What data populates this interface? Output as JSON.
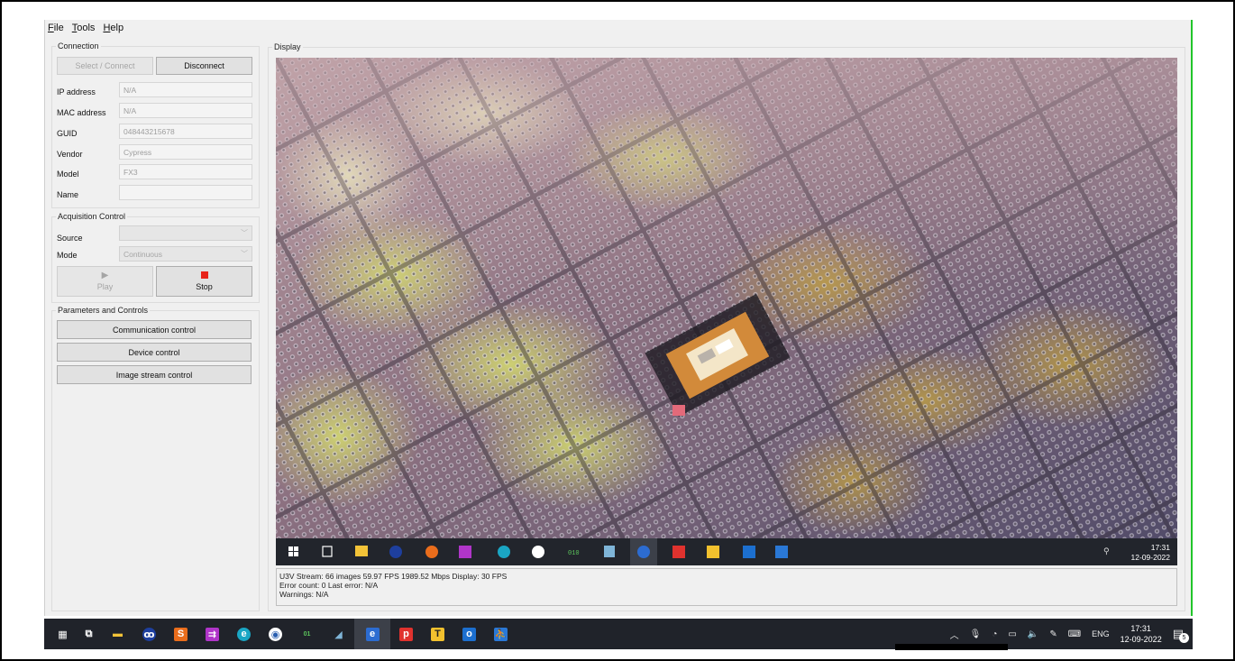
{
  "menu": [
    "File",
    "Tools",
    "Help"
  ],
  "connection": {
    "title": "Connection",
    "select_connect": "Select / Connect",
    "disconnect": "Disconnect",
    "fields": [
      {
        "label": "IP address",
        "value": "N/A"
      },
      {
        "label": "MAC address",
        "value": "N/A"
      },
      {
        "label": "GUID",
        "value": "048443215678"
      },
      {
        "label": "Vendor",
        "value": "Cypress"
      },
      {
        "label": "Model",
        "value": "FX3"
      },
      {
        "label": "Name",
        "value": ""
      }
    ]
  },
  "acquisition": {
    "title": "Acquisition Control",
    "source_label": "Source",
    "source_value": "",
    "mode_label": "Mode",
    "mode_value": "Continuous",
    "play": "Play",
    "stop": "Stop"
  },
  "parameters": {
    "title": "Parameters and Controls",
    "buttons": [
      "Communication control",
      "Device control",
      "Image stream control"
    ]
  },
  "display": {
    "title": "Display",
    "inner_clock_time": "17:31",
    "inner_clock_date": "12-09-2022"
  },
  "status": {
    "line1": "U3V Stream: 66 images   59.97 FPS   1989.52 Mbps   Display: 30 FPS",
    "line2": "Error count: 0   Last error: N/A",
    "line3": "Warnings: N/A"
  },
  "taskbar": {
    "tray_lang": "ENG",
    "clock_time": "17:31",
    "clock_date": "12-09-2022",
    "notification_count": "5"
  },
  "taskbar_icons": [
    {
      "name": "windows-start-icon",
      "glyph": "▦",
      "color": "#ffffff",
      "bg": "transparent"
    },
    {
      "name": "task-view-icon",
      "glyph": "⧉",
      "color": "#ffffff",
      "bg": "transparent"
    },
    {
      "name": "file-explorer-icon",
      "glyph": "▬",
      "color": "#f3c338",
      "bg": "transparent"
    },
    {
      "name": "app-blue-circle-icon",
      "glyph": "ꝏ",
      "color": "#ffffff",
      "bg": "#1e3f9e"
    },
    {
      "name": "app-orange-swirl-icon",
      "glyph": "S",
      "color": "#ffffff",
      "bg": "#ea6d1c"
    },
    {
      "name": "app-purple-arrow-icon",
      "glyph": "⇉",
      "color": "#ffffff",
      "bg": "#b035c9"
    },
    {
      "name": "edge-browser-icon",
      "glyph": "e",
      "color": "#ffffff",
      "bg": "#1aa6c4"
    },
    {
      "name": "cypress-app-icon",
      "glyph": "◉",
      "color": "#2a5fb0",
      "bg": "#ffffff"
    },
    {
      "name": "binary-app-icon",
      "glyph": "01",
      "color": "#5cc55c",
      "bg": "transparent"
    },
    {
      "name": "notes-app-icon",
      "glyph": "◢",
      "color": "#7fb5d8",
      "bg": "transparent"
    },
    {
      "name": "internet-explorer-icon",
      "glyph": "e",
      "color": "#ffffff",
      "bg": "#2c6cd1"
    },
    {
      "name": "app-red-p-icon",
      "glyph": "p",
      "color": "#ffffff",
      "bg": "#e0322e"
    },
    {
      "name": "app-yellow-t-icon",
      "glyph": "T",
      "color": "#222222",
      "bg": "#f2c12e"
    },
    {
      "name": "outlook-icon",
      "glyph": "o",
      "color": "#ffffff",
      "bg": "#1c6fcf"
    },
    {
      "name": "app-blue-person-icon",
      "glyph": "⛹",
      "color": "#ffffff",
      "bg": "#2a78d6"
    }
  ],
  "colors": {
    "accent_border": "#22c52a",
    "stop_red": "#e8231a",
    "taskbar_bg": "#20232a"
  }
}
